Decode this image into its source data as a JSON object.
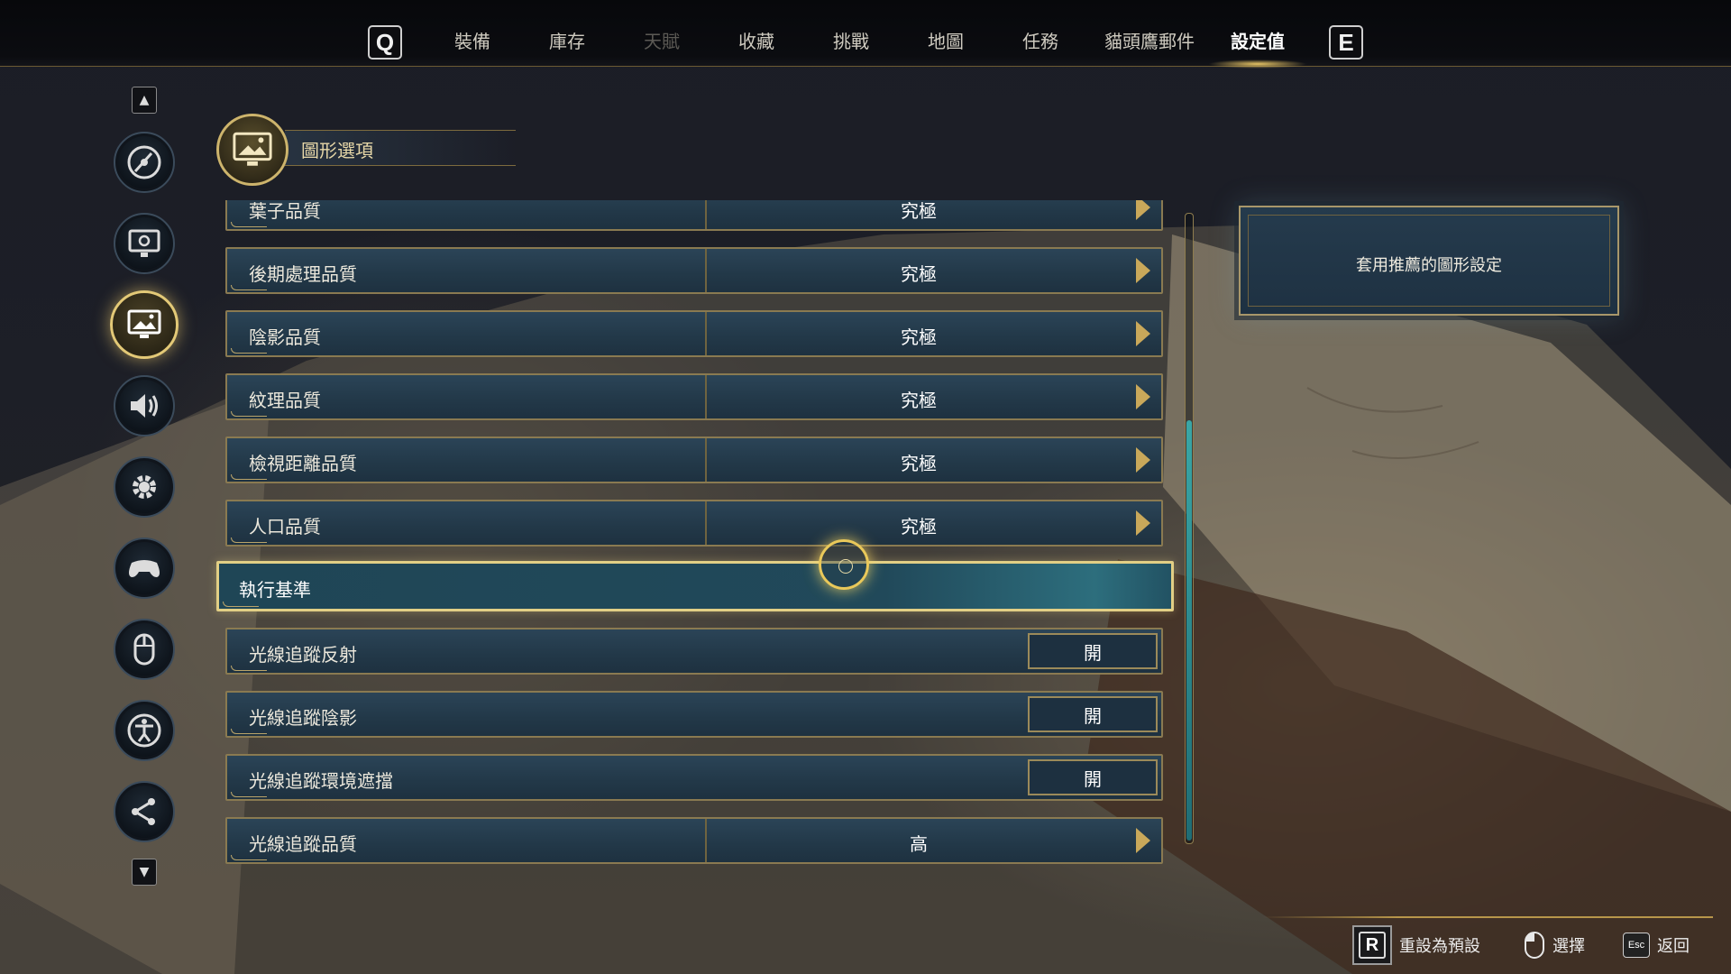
{
  "topnav": {
    "left_key": "Q",
    "right_key": "E",
    "tabs": [
      {
        "label": "裝備"
      },
      {
        "label": "庫存"
      },
      {
        "label": "天賦"
      },
      {
        "label": "收藏"
      },
      {
        "label": "挑戰"
      },
      {
        "label": "地圖"
      },
      {
        "label": "任務"
      },
      {
        "label": "貓頭鷹郵件"
      },
      {
        "label": "設定值"
      }
    ],
    "active_tab": "設定值",
    "disabled_tab": "天賦"
  },
  "sidebar": {
    "items": [
      {
        "icon": "disc-icon"
      },
      {
        "icon": "monitor-gear-icon"
      },
      {
        "icon": "image-monitor-icon",
        "active": true
      },
      {
        "icon": "speaker-icon"
      },
      {
        "icon": "gear-icon"
      },
      {
        "icon": "gamepad-icon"
      },
      {
        "icon": "mouse-icon"
      },
      {
        "icon": "accessibility-icon"
      },
      {
        "icon": "share-icon"
      }
    ]
  },
  "section": {
    "title": "圖形選項",
    "icon": "image-monitor-icon"
  },
  "settings": {
    "rows": [
      {
        "label": "葉子品質",
        "value": "究極"
      },
      {
        "label": "後期處理品質",
        "value": "究極"
      },
      {
        "label": "陰影品質",
        "value": "究極"
      },
      {
        "label": "紋理品質",
        "value": "究極"
      },
      {
        "label": "檢視距離品質",
        "value": "究極"
      },
      {
        "label": "人口品質",
        "value": "究極"
      },
      {
        "label": "執行基準"
      },
      {
        "label": "光線追蹤反射",
        "value": "開"
      },
      {
        "label": "光線追蹤陰影",
        "value": "開"
      },
      {
        "label": "光線追蹤環境遮擋",
        "value": "開"
      },
      {
        "label": "光線追蹤品質",
        "value": "高"
      }
    ]
  },
  "right_panel": {
    "apply_label": "套用推薦的圖形設定"
  },
  "bottom_hints": {
    "reset_key": "R",
    "reset_label": "重設為預設",
    "select_label": "選擇",
    "back_key": "Esc",
    "back_label": "返回"
  },
  "colors": {
    "accent_gold": "#e3c977",
    "row_blue": "#223848",
    "scroll_teal": "#3aa7a6"
  }
}
